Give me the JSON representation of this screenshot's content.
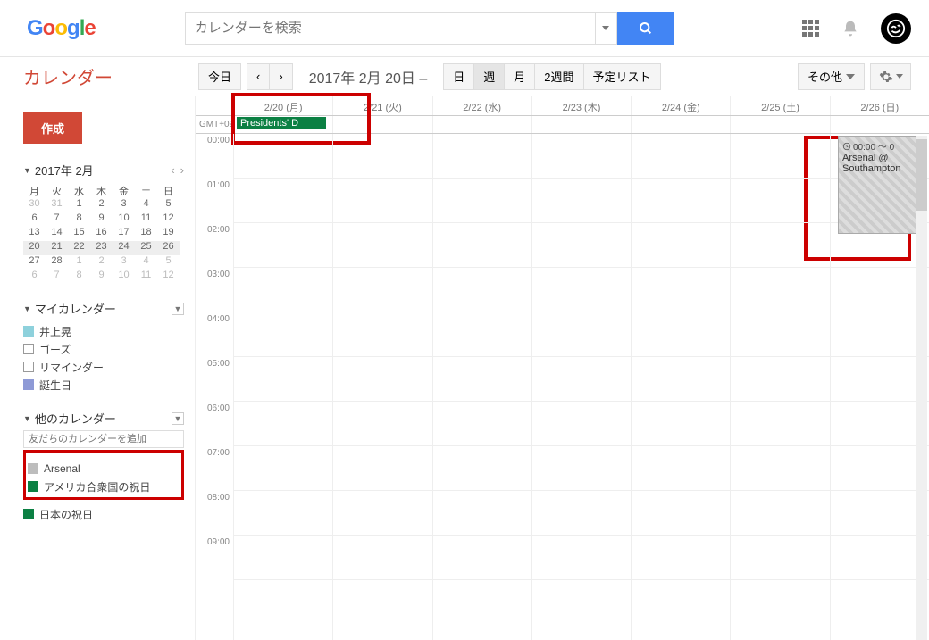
{
  "header": {
    "search_placeholder": "カレンダーを検索"
  },
  "toolbar": {
    "app_title": "カレンダー",
    "today": "今日",
    "date_range": "2017年 2月 20日 –",
    "views": {
      "day": "日",
      "week": "週",
      "month": "月",
      "two_weeks": "2週間",
      "agenda": "予定リスト"
    },
    "other": "その他"
  },
  "sidebar": {
    "create": "作成",
    "mini_title": "2017年 2月",
    "weekdays": [
      "月",
      "火",
      "水",
      "木",
      "金",
      "土",
      "日"
    ],
    "rows": [
      {
        "d": [
          "30",
          "31",
          "1",
          "2",
          "3",
          "4",
          "5"
        ],
        "dim": [
          0,
          1
        ]
      },
      {
        "d": [
          "6",
          "7",
          "8",
          "9",
          "10",
          "11",
          "12"
        ],
        "dim": []
      },
      {
        "d": [
          "13",
          "14",
          "15",
          "16",
          "17",
          "18",
          "19"
        ],
        "dim": []
      },
      {
        "d": [
          "20",
          "21",
          "22",
          "23",
          "24",
          "25",
          "26"
        ],
        "dim": [],
        "hl": true
      },
      {
        "d": [
          "27",
          "28",
          "1",
          "2",
          "3",
          "4",
          "5"
        ],
        "dim": [
          2,
          3,
          4,
          5,
          6
        ]
      },
      {
        "d": [
          "6",
          "7",
          "8",
          "9",
          "10",
          "11",
          "12"
        ],
        "dim": [
          0,
          1,
          2,
          3,
          4,
          5,
          6
        ]
      }
    ],
    "my_cal_title": "マイカレンダー",
    "my_cals": [
      {
        "label": "井上晃",
        "color": "#8ed1dc",
        "checked": true
      },
      {
        "label": "ゴーズ",
        "color": "",
        "checked": false
      },
      {
        "label": "リマインダー",
        "color": "",
        "checked": false
      },
      {
        "label": "誕生日",
        "color": "#8e9ad6",
        "checked": true
      }
    ],
    "other_cal_title": "他のカレンダー",
    "other_input_ph": "友だちのカレンダーを追加",
    "other_cals": [
      {
        "label": "Arsenal",
        "color": "#bdbdbd",
        "checked": true
      },
      {
        "label": "アメリカ合衆国の祝日",
        "color": "#0b8043",
        "checked": true
      },
      {
        "label": "日本の祝日",
        "color": "#0b8043",
        "checked": true
      }
    ]
  },
  "grid": {
    "gmt": "GMT+09",
    "days": [
      "2/20 (月)",
      "2/21 (火)",
      "2/22 (水)",
      "2/23 (木)",
      "2/24 (金)",
      "2/25 (土)",
      "2/26 (日)"
    ],
    "holiday_event": "Presidents' D",
    "hours": [
      "00:00",
      "01:00",
      "02:00",
      "03:00",
      "04:00",
      "05:00",
      "06:00",
      "07:00",
      "08:00",
      "09:00"
    ],
    "event": {
      "time": "00:00 ～ 0",
      "title": "Arsenal @ Southampton"
    }
  }
}
